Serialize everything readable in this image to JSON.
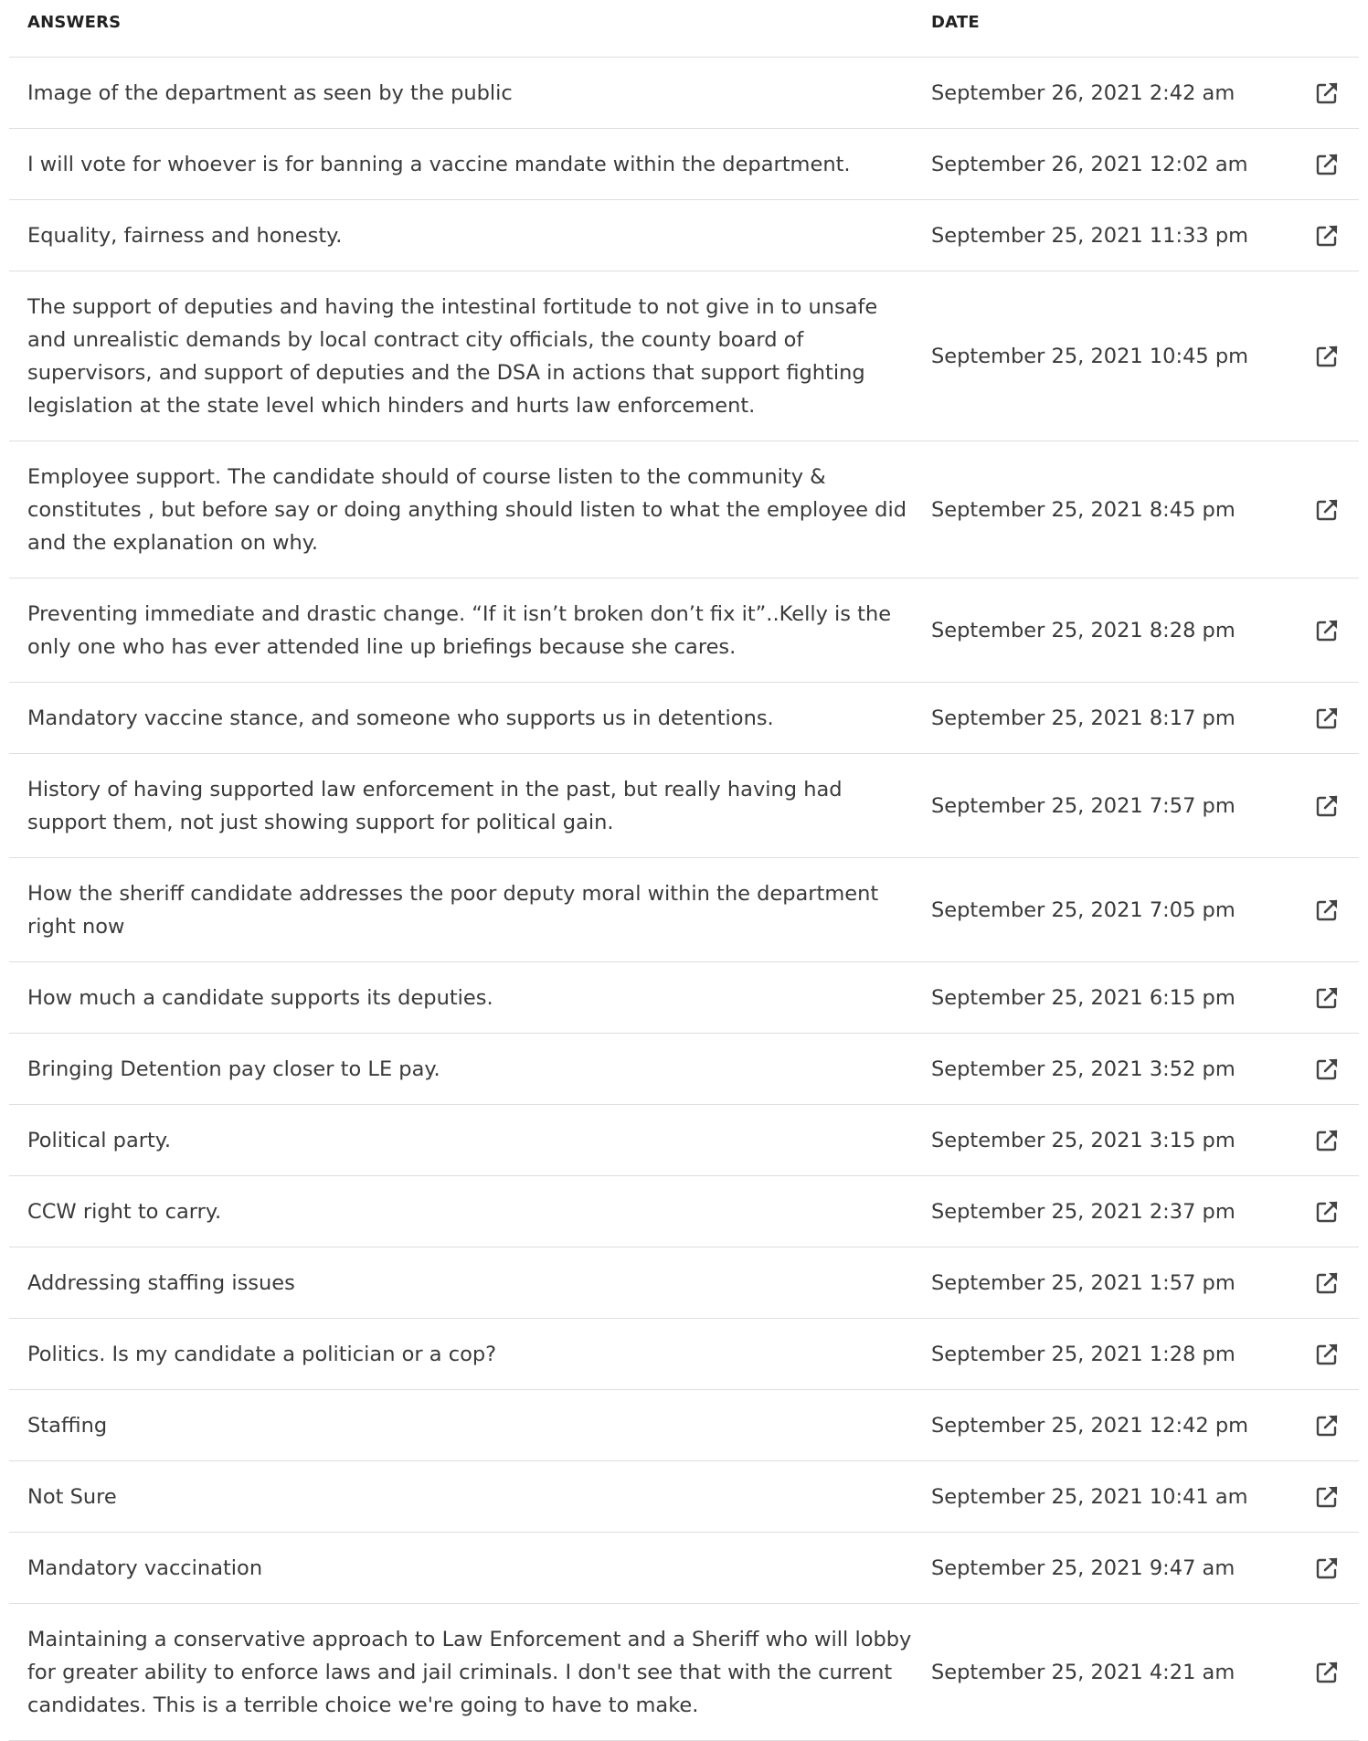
{
  "table": {
    "header": {
      "answers": "ANSWERS",
      "date": "DATE"
    },
    "rows": [
      {
        "answer": "Image of the department as seen by the public",
        "date": "September 26, 2021 2:42 am",
        "icon": "external-link-icon"
      },
      {
        "answer": "I will vote for whoever is for banning a vaccine mandate within the department.",
        "date": "September 26, 2021 12:02 am",
        "icon": "external-link-icon"
      },
      {
        "answer": "Equality, fairness and honesty.",
        "date": "September 25, 2021 11:33 pm",
        "icon": "external-link-icon"
      },
      {
        "answer": "The support of deputies and having the intestinal fortitude to not give in to unsafe and unrealistic demands by local contract city officials, the county board of supervisors, and support of deputies and the DSA in actions that support fighting legislation at the state level which hinders and hurts law enforcement.",
        "date": "September 25, 2021 10:45 pm",
        "icon": "external-link-icon"
      },
      {
        "answer": "Employee support. The candidate should of course listen to the community & constitutes , but before say or doing anything should listen to what the employee did and the explanation on why.",
        "date": "September 25, 2021 8:45 pm",
        "icon": "external-link-icon"
      },
      {
        "answer": "Preventing immediate and drastic change. “If it isn’t broken don’t fix it”..Kelly is the only one who has ever attended line up briefings because she cares.",
        "date": "September 25, 2021 8:28 pm",
        "icon": "external-link-icon"
      },
      {
        "answer": "Mandatory vaccine stance, and someone who supports us in detentions.",
        "date": "September 25, 2021 8:17 pm",
        "icon": "external-link-icon"
      },
      {
        "answer": "History of having supported law enforcement in the past, but really having had support them, not just showing support for political gain.",
        "date": "September 25, 2021 7:57 pm",
        "icon": "external-link-icon"
      },
      {
        "answer": "How the sheriff candidate addresses the poor deputy moral within the department right now",
        "date": "September 25, 2021 7:05 pm",
        "icon": "external-link-icon"
      },
      {
        "answer": "How much a candidate supports its deputies.",
        "date": "September 25, 2021 6:15 pm",
        "icon": "external-link-icon"
      },
      {
        "answer": "Bringing Detention pay closer to LE pay.",
        "date": "September 25, 2021 3:52 pm",
        "icon": "external-link-icon"
      },
      {
        "answer": "Political party.",
        "date": "September 25, 2021 3:15 pm",
        "icon": "external-link-icon"
      },
      {
        "answer": "CCW right to carry.",
        "date": "September 25, 2021 2:37 pm",
        "icon": "external-link-icon"
      },
      {
        "answer": "Addressing staffing issues",
        "date": "September 25, 2021 1:57 pm",
        "icon": "external-link-icon"
      },
      {
        "answer": "Politics. Is my candidate a politician or a cop?",
        "date": "September 25, 2021 1:28 pm",
        "icon": "external-link-icon"
      },
      {
        "answer": "Staffing",
        "date": "September 25, 2021 12:42 pm",
        "icon": "external-link-icon"
      },
      {
        "answer": "Not Sure",
        "date": "September 25, 2021 10:41 am",
        "icon": "external-link-icon"
      },
      {
        "answer": "Mandatory vaccination",
        "date": "September 25, 2021 9:47 am",
        "icon": "external-link-icon"
      },
      {
        "answer": "Maintaining a conservative approach to Law Enforcement and a Sheriff who will lobby for greater ability to enforce laws and jail criminals. I don't see that with the current candidates. This is a terrible choice we're going to have to make.",
        "date": "September 25, 2021 4:21 am",
        "icon": "external-link-icon"
      }
    ]
  }
}
